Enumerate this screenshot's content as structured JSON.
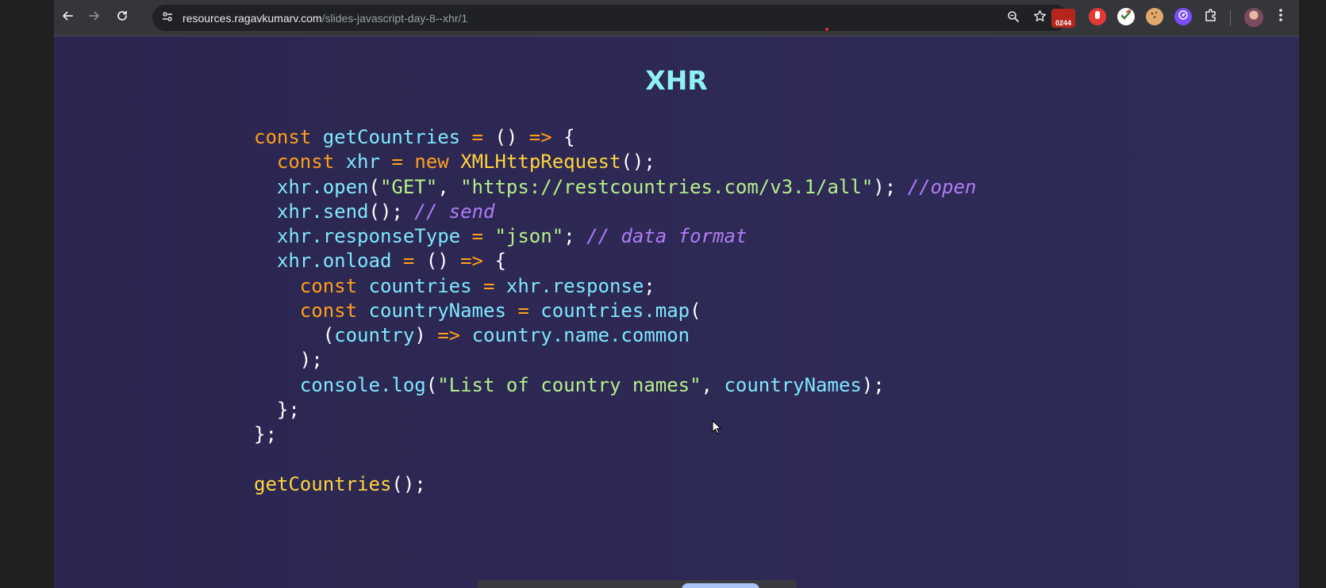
{
  "browser": {
    "url_host": "resources.ragavkumarv.com",
    "url_path": "/slides-javascript-day-8--xhr/1",
    "extension_badge": "0244"
  },
  "icons": [
    "back-arrow-icon",
    "forward-arrow-icon",
    "reload-icon",
    "site-info-icon",
    "zoom-icon",
    "star-icon",
    "extension-icon",
    "puzzle-icon",
    "more-vert-icon"
  ],
  "slide": {
    "title": "XHR",
    "code": [
      [
        {
          "t": "const",
          "c": "kw"
        },
        {
          "t": " ",
          "c": "p"
        },
        {
          "t": "getCountries",
          "c": "id"
        },
        {
          "t": " ",
          "c": "p"
        },
        {
          "t": "=",
          "c": "kw"
        },
        {
          "t": " () ",
          "c": "p"
        },
        {
          "t": "=>",
          "c": "kw"
        },
        {
          "t": " {",
          "c": "p"
        }
      ],
      [
        {
          "t": "  ",
          "c": "p"
        },
        {
          "t": "const",
          "c": "kw"
        },
        {
          "t": " ",
          "c": "p"
        },
        {
          "t": "xhr",
          "c": "id"
        },
        {
          "t": " ",
          "c": "p"
        },
        {
          "t": "=",
          "c": "kw"
        },
        {
          "t": " ",
          "c": "p"
        },
        {
          "t": "new",
          "c": "kw"
        },
        {
          "t": " ",
          "c": "p"
        },
        {
          "t": "XMLHttpRequest",
          "c": "fn"
        },
        {
          "t": "();",
          "c": "p"
        }
      ],
      [
        {
          "t": "  ",
          "c": "p"
        },
        {
          "t": "xhr.open",
          "c": "id"
        },
        {
          "t": "(",
          "c": "p"
        },
        {
          "t": "\"GET\"",
          "c": "str"
        },
        {
          "t": ", ",
          "c": "p"
        },
        {
          "t": "\"https://restcountries.com/v3.1/all\"",
          "c": "str"
        },
        {
          "t": "); ",
          "c": "p"
        },
        {
          "t": "//open",
          "c": "cmt"
        }
      ],
      [
        {
          "t": "  ",
          "c": "p"
        },
        {
          "t": "xhr.send",
          "c": "id"
        },
        {
          "t": "(); ",
          "c": "p"
        },
        {
          "t": "// send",
          "c": "cmt"
        }
      ],
      [
        {
          "t": "  ",
          "c": "p"
        },
        {
          "t": "xhr.responseType",
          "c": "id"
        },
        {
          "t": " ",
          "c": "p"
        },
        {
          "t": "=",
          "c": "kw"
        },
        {
          "t": " ",
          "c": "p"
        },
        {
          "t": "\"json\"",
          "c": "str"
        },
        {
          "t": "; ",
          "c": "p"
        },
        {
          "t": "// data format",
          "c": "cmt"
        }
      ],
      [
        {
          "t": "  ",
          "c": "p"
        },
        {
          "t": "xhr.onload",
          "c": "id"
        },
        {
          "t": " ",
          "c": "p"
        },
        {
          "t": "=",
          "c": "kw"
        },
        {
          "t": " () ",
          "c": "p"
        },
        {
          "t": "=>",
          "c": "kw"
        },
        {
          "t": " {",
          "c": "p"
        }
      ],
      [
        {
          "t": "    ",
          "c": "p"
        },
        {
          "t": "const",
          "c": "kw"
        },
        {
          "t": " ",
          "c": "p"
        },
        {
          "t": "countries",
          "c": "id"
        },
        {
          "t": " ",
          "c": "p"
        },
        {
          "t": "=",
          "c": "kw"
        },
        {
          "t": " ",
          "c": "p"
        },
        {
          "t": "xhr.response",
          "c": "id"
        },
        {
          "t": ";",
          "c": "p"
        }
      ],
      [
        {
          "t": "    ",
          "c": "p"
        },
        {
          "t": "const",
          "c": "kw"
        },
        {
          "t": " ",
          "c": "p"
        },
        {
          "t": "countryNames",
          "c": "id"
        },
        {
          "t": " ",
          "c": "p"
        },
        {
          "t": "=",
          "c": "kw"
        },
        {
          "t": " ",
          "c": "p"
        },
        {
          "t": "countries.map",
          "c": "id"
        },
        {
          "t": "(",
          "c": "p"
        }
      ],
      [
        {
          "t": "      (",
          "c": "p"
        },
        {
          "t": "country",
          "c": "id"
        },
        {
          "t": ") ",
          "c": "p"
        },
        {
          "t": "=>",
          "c": "kw"
        },
        {
          "t": " ",
          "c": "p"
        },
        {
          "t": "country.name.common",
          "c": "id"
        }
      ],
      [
        {
          "t": "    );",
          "c": "p"
        }
      ],
      [
        {
          "t": "    ",
          "c": "p"
        },
        {
          "t": "console.log",
          "c": "id"
        },
        {
          "t": "(",
          "c": "p"
        },
        {
          "t": "\"List of country names\"",
          "c": "str"
        },
        {
          "t": ", ",
          "c": "p"
        },
        {
          "t": "countryNames",
          "c": "id"
        },
        {
          "t": ");",
          "c": "p"
        }
      ],
      [
        {
          "t": "  };",
          "c": "p"
        }
      ],
      [
        {
          "t": "};",
          "c": "p"
        }
      ],
      [
        {
          "t": "",
          "c": "p"
        }
      ],
      [
        {
          "t": "getCountries",
          "c": "fn"
        },
        {
          "t": "();",
          "c": "p"
        }
      ]
    ]
  },
  "colors": {
    "page_bg": "#2d2954",
    "title": "#8ff0f4",
    "keyword": "#ff9f1c",
    "identifier": "#7fe7ff",
    "string": "#b5f08a",
    "comment": "#b07cf5",
    "function": "#ffd43b"
  }
}
